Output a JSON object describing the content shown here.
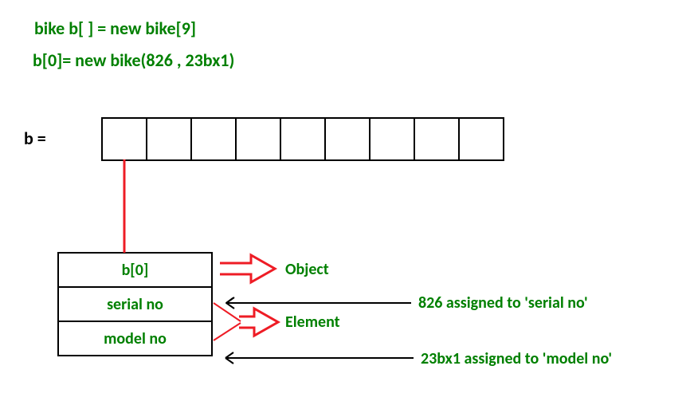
{
  "code": {
    "line1": "bike b[ ] = new bike[9]",
    "line2": "b[0]= new bike(826 , 23bx1)"
  },
  "array_label": "b  =",
  "array_size": 9,
  "object_rows": {
    "header": "b[0]",
    "field1": "serial no",
    "field2": "model no"
  },
  "labels": {
    "object": "Object",
    "element": "Element",
    "assign1": "826 assigned to 'serial no'",
    "assign2": "23bx1 assigned to 'model no'"
  },
  "colors": {
    "text_green": "#008000",
    "arrow_red": "#ee1c25",
    "line_black": "#000000"
  }
}
